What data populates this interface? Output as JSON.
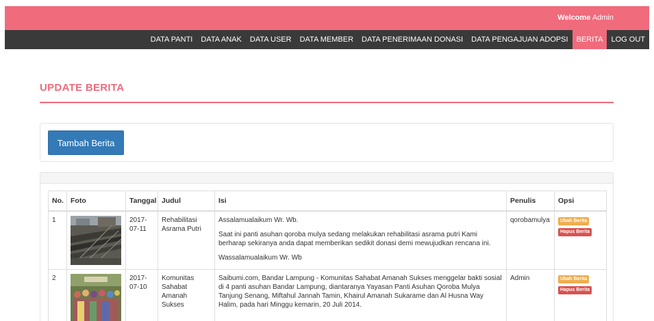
{
  "header": {
    "welcome_prefix": "Welcome",
    "welcome_user": "Admin"
  },
  "nav": {
    "items": [
      {
        "label": "DATA PANTI"
      },
      {
        "label": "DATA ANAK"
      },
      {
        "label": "DATA USER"
      },
      {
        "label": "DATA MEMBER"
      },
      {
        "label": "DATA PENERIMAAN DONASI"
      },
      {
        "label": "DATA PENGAJUAN ADOPSI"
      },
      {
        "label": "BERITA"
      },
      {
        "label": "LOG OUT"
      }
    ],
    "active": "BERITA"
  },
  "page": {
    "title": "UPDATE BERITA",
    "add_button": "Tambah Berita"
  },
  "table": {
    "headers": {
      "no": "No.",
      "foto": "Foto",
      "tanggal": "Tanggal",
      "judul": "Judul",
      "isi": "Isi",
      "penulis": "Penulis",
      "opsi": "Opsi"
    },
    "rows": [
      {
        "no": "1",
        "tanggal": "2017-07-11",
        "judul": "Rehabilitasi Asrama Putri",
        "isi_1": "Assalamualaikum Wr. Wb.",
        "isi_2": "Saat ini panti asuhan qoroba mulya sedang melakukan rehabilitasi asrama putri Kami berharap sekiranya anda dapat memberikan sedikit donasi demi mewujudkan rencana ini.",
        "isi_3": "Wassalamualaikum Wr. Wb",
        "penulis": "qorobamulya",
        "ubah": "Ubah Berita",
        "hapus": "Hapus Berita"
      },
      {
        "no": "2",
        "tanggal": "2017-07-10",
        "judul": "Komunitas Sahabat Amanah Sukses",
        "isi_1": "Saibumi.com, Bandar Lampung - Komunitas Sahabat Amanah Sukses menggelar bakti sosial di 4 panti asuhan Bandar Lampung, diantaranya Yayasan Panti Asuhan Qoroba Mulya Tanjung Senang, Miftahul Jannah Tamin, Khairul Amanah Sukarame dan Al Husna Way Halim, pada hari Minggu kemarin, 20 Juli 2014.",
        "penulis": "Admin",
        "ubah": "Ubah Berita",
        "hapus": "Hapus Berita"
      }
    ]
  },
  "colors": {
    "brand": "#f06b7c",
    "navbar": "#3a3a3a",
    "primary_button": "#337ab7",
    "badge_ubah": "#f0ad4e",
    "badge_hapus": "#d9534f"
  }
}
